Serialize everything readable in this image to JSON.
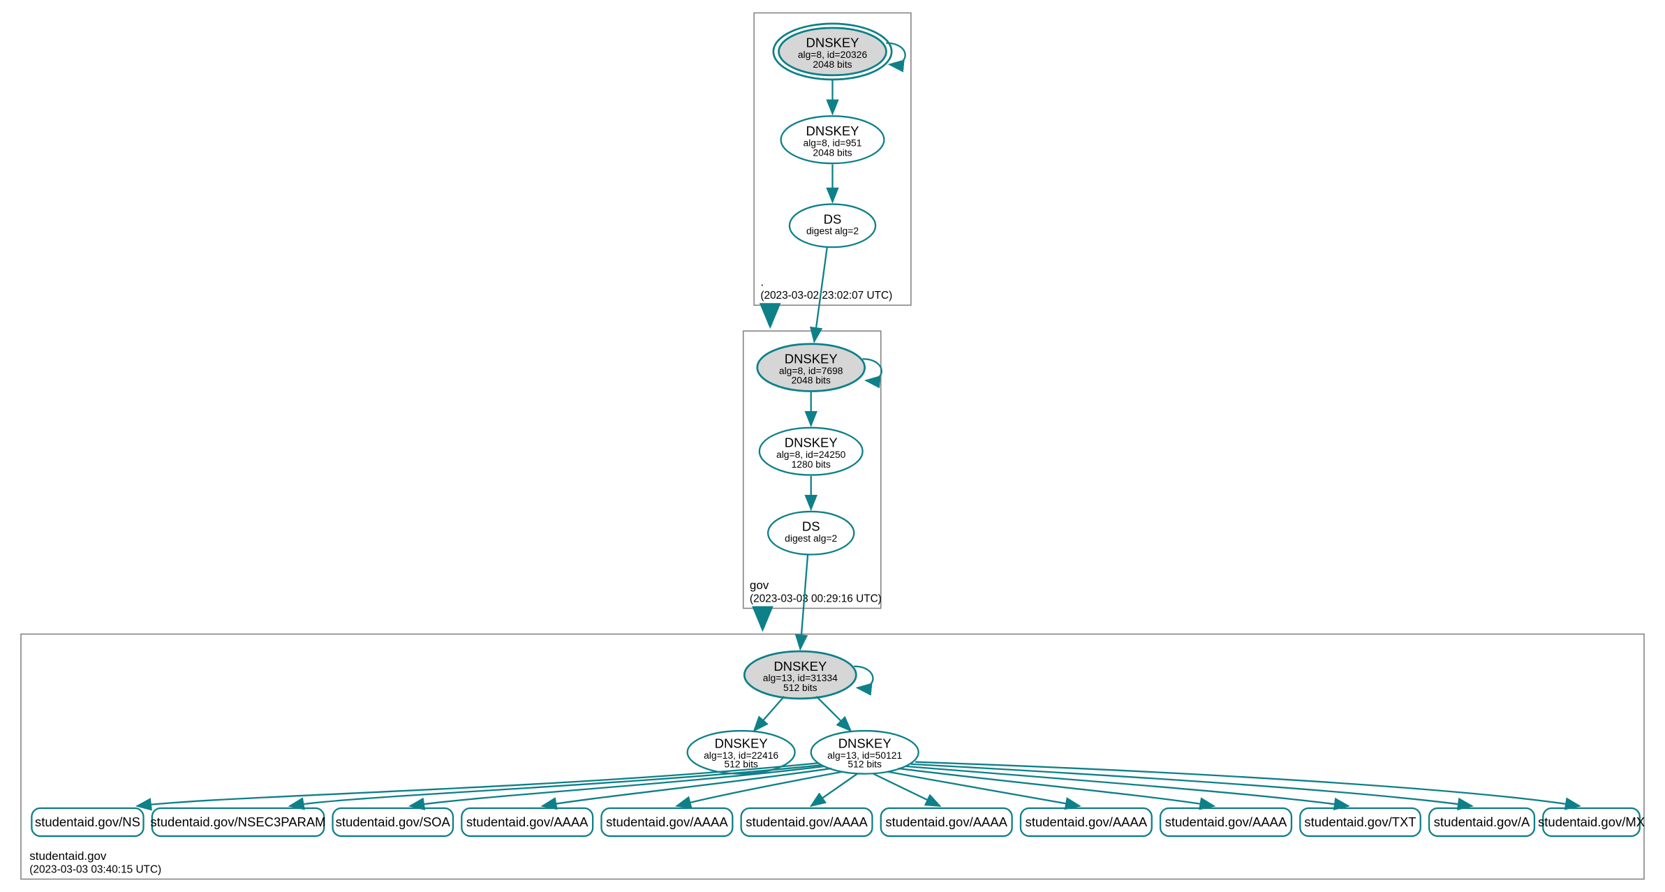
{
  "zones": {
    "root": {
      "label": ".",
      "timestamp": "(2023-03-02 23:02:07 UTC)"
    },
    "gov": {
      "label": "gov",
      "timestamp": "(2023-03-03 00:29:16 UTC)"
    },
    "studentaid": {
      "label": "studentaid.gov",
      "timestamp": "(2023-03-03 03:40:15 UTC)"
    }
  },
  "nodes": {
    "root_ksk": {
      "title": "DNSKEY",
      "sub1": "alg=8, id=20326",
      "sub2": "2048 bits"
    },
    "root_zsk": {
      "title": "DNSKEY",
      "sub1": "alg=8, id=951",
      "sub2": "2048 bits"
    },
    "root_ds": {
      "title": "DS",
      "sub1": "digest alg=2"
    },
    "gov_ksk": {
      "title": "DNSKEY",
      "sub1": "alg=8, id=7698",
      "sub2": "2048 bits"
    },
    "gov_zsk": {
      "title": "DNSKEY",
      "sub1": "alg=8, id=24250",
      "sub2": "1280 bits"
    },
    "gov_ds": {
      "title": "DS",
      "sub1": "digest alg=2"
    },
    "sa_ksk": {
      "title": "DNSKEY",
      "sub1": "alg=13, id=31334",
      "sub2": "512 bits"
    },
    "sa_zsk1": {
      "title": "DNSKEY",
      "sub1": "alg=13, id=22416",
      "sub2": "512 bits"
    },
    "sa_zsk2": {
      "title": "DNSKEY",
      "sub1": "alg=13, id=50121",
      "sub2": "512 bits"
    },
    "rr_ns": {
      "label": "studentaid.gov/NS"
    },
    "rr_n3p": {
      "label": "studentaid.gov/NSEC3PARAM"
    },
    "rr_soa": {
      "label": "studentaid.gov/SOA"
    },
    "rr_aaaa1": {
      "label": "studentaid.gov/AAAA"
    },
    "rr_aaaa2": {
      "label": "studentaid.gov/AAAA"
    },
    "rr_aaaa3": {
      "label": "studentaid.gov/AAAA"
    },
    "rr_aaaa4": {
      "label": "studentaid.gov/AAAA"
    },
    "rr_aaaa5": {
      "label": "studentaid.gov/AAAA"
    },
    "rr_aaaa6": {
      "label": "studentaid.gov/AAAA"
    },
    "rr_txt": {
      "label": "studentaid.gov/TXT"
    },
    "rr_a": {
      "label": "studentaid.gov/A"
    },
    "rr_mx": {
      "label": "studentaid.gov/MX"
    }
  }
}
